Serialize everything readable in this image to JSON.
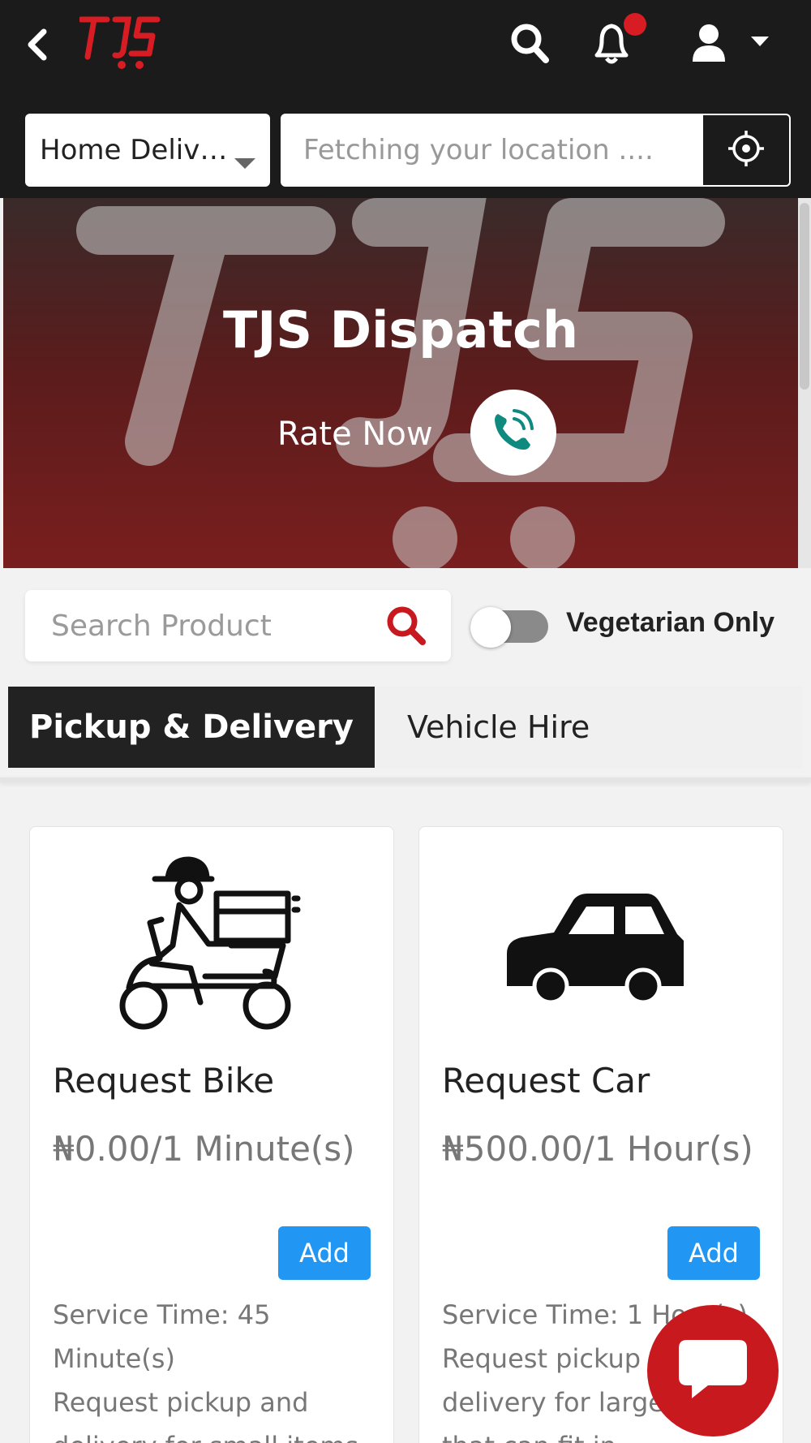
{
  "header": {
    "logo_text": "TJS",
    "icons": [
      "back-icon",
      "search-icon",
      "bell-icon",
      "user-icon",
      "caret-down-icon"
    ],
    "notification_dot_color": "#d71c24"
  },
  "delivery": {
    "mode_label": "Home Delive...",
    "location_placeholder": "Fetching your location ...."
  },
  "hero": {
    "title": "TJS Dispatch",
    "rate_label": "Rate Now"
  },
  "filters": {
    "search_placeholder": "Search Product",
    "vegetarian_label": "Vegetarian Only",
    "vegetarian_on": false
  },
  "tabs": [
    {
      "label": "Pickup & Delivery",
      "active": true
    },
    {
      "label": "Vehicle Hire",
      "active": false
    }
  ],
  "products": [
    {
      "title": "Request Bike",
      "price": "₦0.00/1 Minute(s)",
      "add_label": "Add",
      "service_time": "Service Time: 45 Minute(s)",
      "description": "Request pickup and delivery for small items"
    },
    {
      "title": "Request Car",
      "price": "₦500.00/1 Hour(s)",
      "add_label": "Add",
      "service_time": "Service Time: 1 Hour(s)",
      "description": "Request pickup and delivery for large items that can fit in"
    }
  ],
  "colors": {
    "header_bg": "#1b1b1b",
    "brand_red": "#d71c24",
    "add_button": "#2196f3",
    "chat_button": "#c8191f"
  }
}
